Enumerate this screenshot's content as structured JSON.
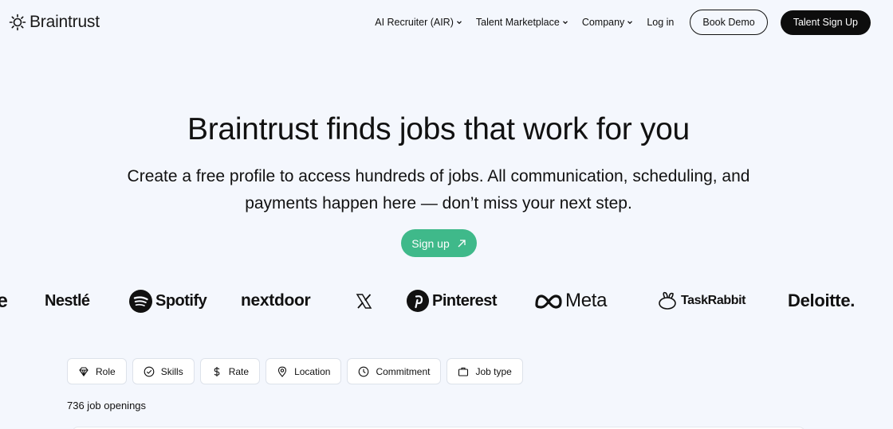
{
  "header": {
    "logo_text": "Braintrust",
    "nav": [
      {
        "label": "AI Recruiter (AIR)",
        "has_dropdown": true
      },
      {
        "label": "Talent Marketplace",
        "has_dropdown": true
      },
      {
        "label": "Company",
        "has_dropdown": true
      },
      {
        "label": "Log in",
        "has_dropdown": false
      }
    ],
    "book_demo": "Book Demo",
    "talent_signup": "Talent Sign Up"
  },
  "hero": {
    "title": "Braintrust finds jobs that work for you",
    "subtitle_line1": "Create a free profile to access hundreds of jobs. All communication, scheduling, and",
    "subtitle_line2": "payments happen here — don’t miss your next step.",
    "cta": "Sign up"
  },
  "logos": [
    "e",
    "Nestlé",
    "Spotify",
    "nextdoor",
    "X",
    "Pinterest",
    "Meta",
    "TaskRabbit",
    "Deloitte."
  ],
  "filters": [
    {
      "label": "Role",
      "icon": "diamond-icon"
    },
    {
      "label": "Skills",
      "icon": "check-circle-icon"
    },
    {
      "label": "Rate",
      "icon": "dollar-icon"
    },
    {
      "label": "Location",
      "icon": "location-pin-icon"
    },
    {
      "label": "Commitment",
      "icon": "clock-icon"
    },
    {
      "label": "Job type",
      "icon": "briefcase-icon"
    }
  ],
  "job_count": "736 job openings",
  "colors": {
    "background": "#f4f7fd",
    "accent": "#3fb98a",
    "dark": "#0d0d0d"
  }
}
